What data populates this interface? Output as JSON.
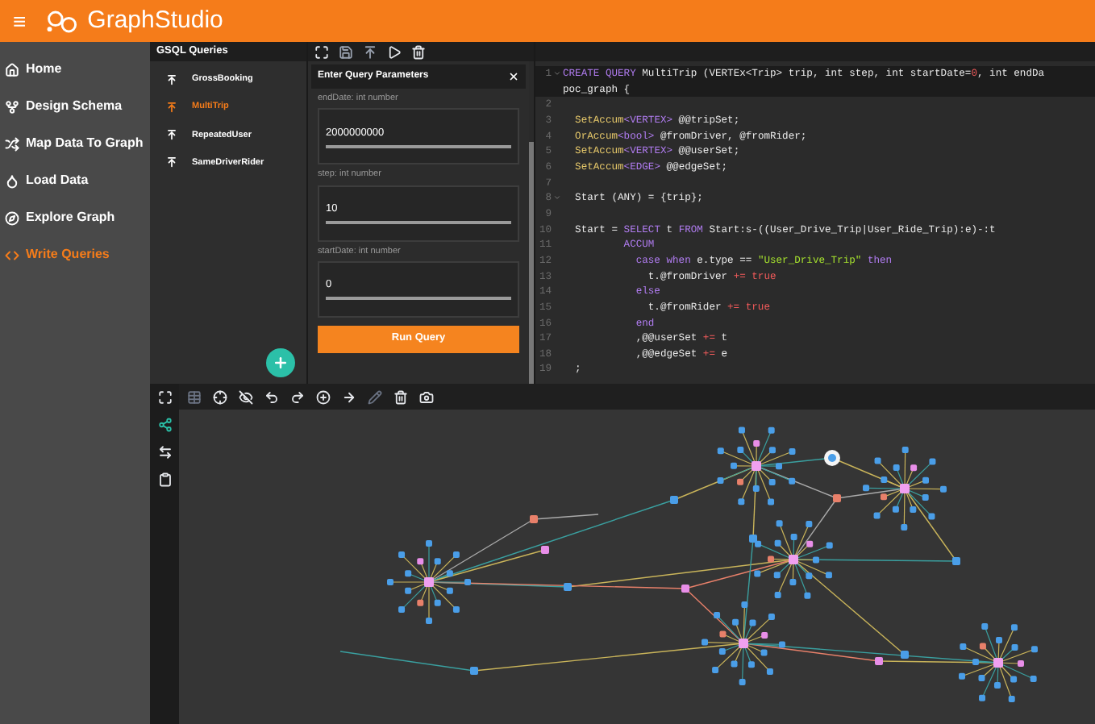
{
  "header": {
    "menu_icon": "≡",
    "logo": "GraphStudio"
  },
  "sidebar": {
    "items": [
      {
        "label": "Home",
        "selected": false
      },
      {
        "label": "Design Schema",
        "selected": false
      },
      {
        "label": "Map Data To Graph",
        "selected": false
      },
      {
        "label": "Load Data",
        "selected": false
      },
      {
        "label": "Explore Graph",
        "selected": false
      },
      {
        "label": "Write Queries",
        "selected": true
      }
    ]
  },
  "queries": {
    "title": "GSQL Queries",
    "items": [
      {
        "label": "GrossBooking",
        "selected": false
      },
      {
        "label": "MultiTrip",
        "selected": true
      },
      {
        "label": "RepeatedUser",
        "selected": false
      },
      {
        "label": "SameDriverRider",
        "selected": false
      }
    ]
  },
  "params": {
    "title": "Enter Query Parameters",
    "fields": [
      {
        "label": "endDate: int number",
        "value": "2000000000"
      },
      {
        "label": "step: int number",
        "value": "10"
      },
      {
        "label": "startDate: int number",
        "value": "0"
      }
    ],
    "button": "Run Query"
  },
  "code": {
    "lines": [
      {
        "number": "1",
        "fold": true,
        "tokens": [
          {
            "kind": "keyword",
            "text": "CREATE QUERY"
          },
          {
            "kind": "plain",
            "text": " MultiTrip (VERTEx<Trip> trip, int step, int startDate="
          },
          {
            "kind": "number",
            "text": "0"
          },
          {
            "kind": "plain",
            "text": ", int endDa"
          }
        ]
      },
      {
        "fold": false,
        "tokens": [
          {
            "kind": "plain",
            "text": "poc_graph {"
          }
        ]
      },
      {
        "number": "2",
        "fold": false
      },
      {
        "number": "3",
        "fold": false,
        "tokens": [
          {
            "kind": "type",
            "text": "  SetAccum"
          },
          {
            "kind": "keyword",
            "text": "<VERTEX>"
          },
          {
            "kind": "plain",
            "text": " @@tripSet;"
          }
        ]
      },
      {
        "number": "4",
        "fold": false,
        "tokens": [
          {
            "kind": "type",
            "text": "  OrAccum"
          },
          {
            "kind": "keyword",
            "text": "<bool>"
          },
          {
            "kind": "plain",
            "text": " @fromDriver, @fromRider;"
          }
        ]
      },
      {
        "number": "5",
        "fold": false,
        "tokens": [
          {
            "kind": "type",
            "text": "  SetAccum"
          },
          {
            "kind": "keyword",
            "text": "<VERTEX>"
          },
          {
            "kind": "plain",
            "text": " @@userSet;"
          }
        ]
      },
      {
        "number": "6",
        "fold": false,
        "tokens": [
          {
            "kind": "type",
            "text": "  SetAccum"
          },
          {
            "kind": "keyword",
            "text": "<EDGE>"
          },
          {
            "kind": "plain",
            "text": " @@edgeSet;"
          }
        ]
      },
      {
        "number": "7",
        "fold": false
      },
      {
        "number": "8",
        "fold": true,
        "tokens": [
          {
            "kind": "plain",
            "text": "  Start (ANY) = {trip};"
          }
        ]
      },
      {
        "number": "9",
        "fold": false
      },
      {
        "number": "10",
        "fold": false,
        "tokens": [
          {
            "kind": "plain",
            "text": "  Start = "
          },
          {
            "kind": "keyword",
            "text": "SELECT"
          },
          {
            "kind": "plain",
            "text": " t "
          },
          {
            "kind": "keyword",
            "text": "FROM"
          },
          {
            "kind": "plain",
            "text": " Start:s-((User_Drive_Trip|User_Ride_Trip):e)-:t"
          }
        ]
      },
      {
        "number": "11",
        "fold": false,
        "tokens": [
          {
            "kind": "keyword",
            "text": "          ACCUM"
          }
        ]
      },
      {
        "number": "12",
        "fold": false,
        "tokens": [
          {
            "kind": "keyword",
            "text": "            case when"
          },
          {
            "kind": "plain",
            "text": " e.type == "
          },
          {
            "kind": "string",
            "text": "\"User_Drive_Trip\""
          },
          {
            "kind": "keyword",
            "text": " then"
          }
        ]
      },
      {
        "number": "13",
        "fold": false,
        "tokens": [
          {
            "kind": "plain",
            "text": "              t.@fromDriver "
          },
          {
            "kind": "number",
            "text": "+= true"
          }
        ]
      },
      {
        "number": "14",
        "fold": false,
        "tokens": [
          {
            "kind": "keyword",
            "text": "            else"
          }
        ]
      },
      {
        "number": "15",
        "fold": false,
        "tokens": [
          {
            "kind": "plain",
            "text": "              t.@fromRider "
          },
          {
            "kind": "number",
            "text": "+= true"
          }
        ]
      },
      {
        "number": "16",
        "fold": false,
        "tokens": [
          {
            "kind": "keyword",
            "text": "            end"
          }
        ]
      },
      {
        "number": "17",
        "fold": false,
        "tokens": [
          {
            "kind": "plain",
            "text": "            ,@@userSet "
          },
          {
            "kind": "number",
            "text": "+="
          },
          {
            "kind": "plain",
            "text": " t"
          }
        ]
      },
      {
        "number": "18",
        "fold": false,
        "tokens": [
          {
            "kind": "plain",
            "text": "            ,@@edgeSet "
          },
          {
            "kind": "number",
            "text": "+="
          },
          {
            "kind": "plain",
            "text": " e"
          }
        ]
      },
      {
        "number": "19",
        "fold": false,
        "tokens": [
          {
            "kind": "plain",
            "text": "  ;"
          }
        ]
      }
    ]
  }
}
